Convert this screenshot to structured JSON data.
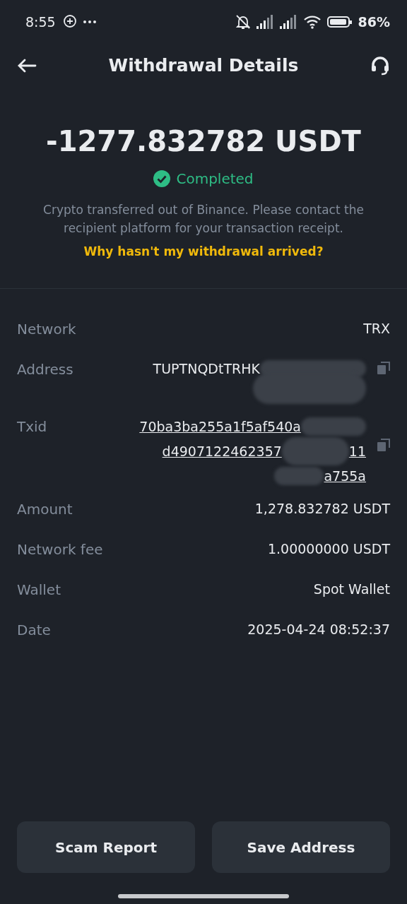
{
  "status_bar": {
    "time": "8:55",
    "battery_percent": "86%"
  },
  "header": {
    "title": "Withdrawal Details"
  },
  "summary": {
    "amount": "-1277.832782 USDT",
    "status": "Completed",
    "note": "Crypto transferred out of Binance. Please contact the recipient platform for your transaction receipt.",
    "help_link": "Why hasn't my withdrawal arrived?"
  },
  "details": [
    {
      "kind": "plain",
      "label": "Network",
      "value": "TRX"
    },
    {
      "kind": "address",
      "label": "Address",
      "value": "TUPTNQDtTRHK",
      "copyable": true
    },
    {
      "kind": "txid",
      "label": "Txid",
      "lines": [
        "70ba3ba255a1f5af540a",
        "d4907122462357",
        "a755a"
      ],
      "tail": "11",
      "copyable": true
    },
    {
      "kind": "plain",
      "label": "Amount",
      "value": "1,278.832782 USDT"
    },
    {
      "kind": "plain",
      "label": "Network fee",
      "value": "1.00000000 USDT"
    },
    {
      "kind": "plain",
      "label": "Wallet",
      "value": "Spot Wallet"
    },
    {
      "kind": "plain",
      "label": "Date",
      "value": "2025-04-24 08:52:37"
    }
  ],
  "buttons": [
    "Scam Report",
    "Save Address"
  ]
}
